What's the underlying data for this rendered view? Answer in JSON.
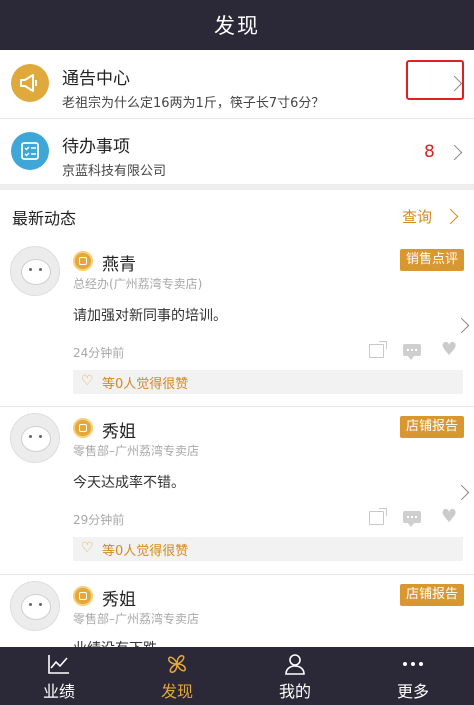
{
  "header": {
    "title": "发现"
  },
  "notice": {
    "title": "通告中心",
    "subtitle": "老祖宗为什么定16两为1斤，筷子长7寸6分？"
  },
  "todo": {
    "title": "待办事项",
    "subtitle": "京蓝科技有限公司",
    "count": "8"
  },
  "feed": {
    "title": "最新动态",
    "query_label": "查询"
  },
  "posts": [
    {
      "name": "燕青",
      "dept": "总经办(广州荔湾专卖店)",
      "content": "请加强对新同事的培训。",
      "time": "24分钟前",
      "tag": "销售点评",
      "likes": "等0人觉得很赞"
    },
    {
      "name": "秀姐",
      "dept": "零售部–广州荔湾专卖店",
      "content": "今天达成率不错。",
      "time": "29分钟前",
      "tag": "店铺报告",
      "likes": "等0人觉得很赞"
    },
    {
      "name": "秀姐",
      "dept": "零售部–广州荔湾专卖店",
      "content": "业绩没有下跌",
      "tag": "店铺报告"
    }
  ],
  "nav": [
    {
      "label": "业绩",
      "icon": "chart-line-icon"
    },
    {
      "label": "发现",
      "icon": "pinwheel-icon",
      "active": true
    },
    {
      "label": "我的",
      "icon": "person-icon"
    },
    {
      "label": "更多",
      "icon": "more-dots-icon"
    }
  ],
  "colors": {
    "bar": "#2b2838",
    "accent": "#d9982f",
    "badge_red": "#e02020",
    "notice_icon": "#dfa93b",
    "todo_icon": "#3fa6d8"
  }
}
